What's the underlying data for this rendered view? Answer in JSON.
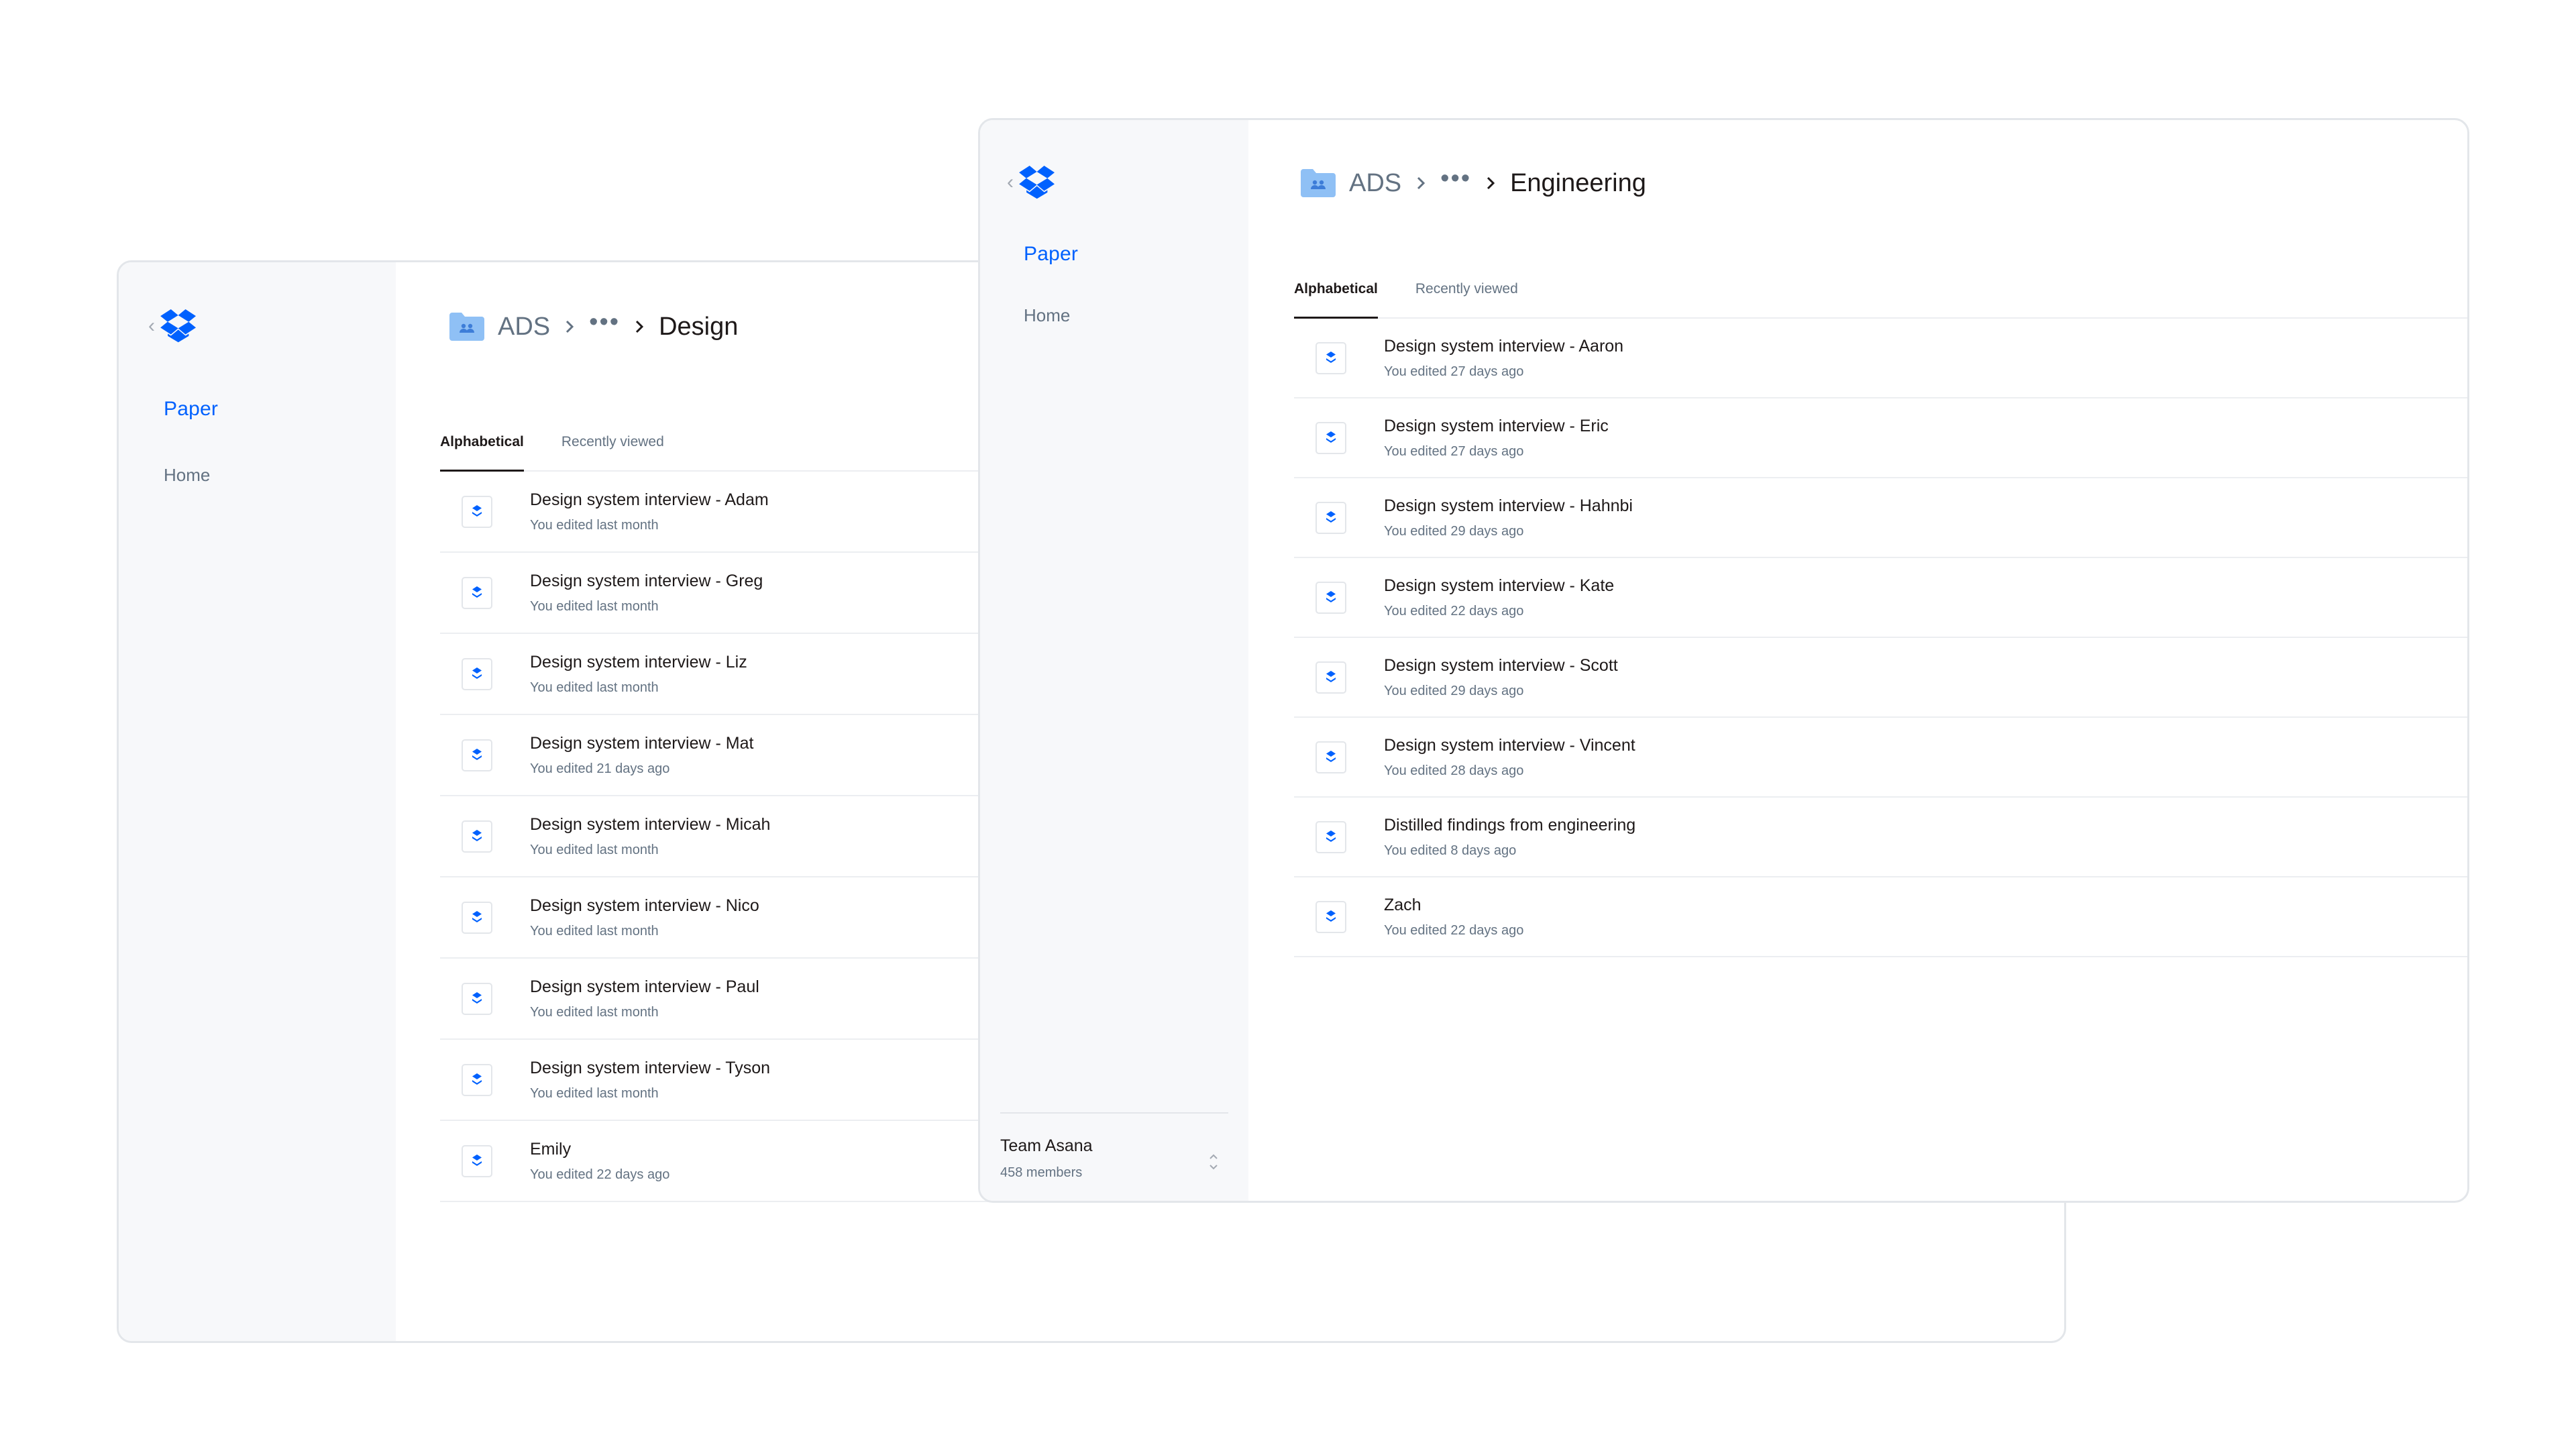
{
  "colors": {
    "accent": "#0061fe",
    "text_primary": "#1e1919",
    "text_secondary": "#637282",
    "folder": "#8fc0f5",
    "sidebar_bg": "#f7f8fa"
  },
  "back_window": {
    "sidebar": {
      "back_chevron": "‹",
      "logo_icon": "dropbox-logo-icon",
      "nav_paper": "Paper",
      "nav_home": "Home"
    },
    "breadcrumb": {
      "folder_icon": "team-folder-icon",
      "root": "ADS",
      "ellipsis": "•••",
      "current": "Design"
    },
    "tabs": [
      {
        "label": "Alphabetical",
        "active": true
      },
      {
        "label": "Recently viewed",
        "active": false
      }
    ],
    "docs": [
      {
        "title": "Design system interview - Adam",
        "subtitle": "You edited last month"
      },
      {
        "title": "Design system interview - Greg",
        "subtitle": "You edited last month"
      },
      {
        "title": "Design system interview - Liz",
        "subtitle": "You edited last month"
      },
      {
        "title": "Design system interview - Mat",
        "subtitle": "You edited 21 days ago"
      },
      {
        "title": "Design system interview - Micah",
        "subtitle": "You edited last month"
      },
      {
        "title": "Design system interview - Nico",
        "subtitle": "You edited last month"
      },
      {
        "title": "Design system interview - Paul",
        "subtitle": "You edited last month"
      },
      {
        "title": "Design system interview - Tyson",
        "subtitle": "You edited last month"
      },
      {
        "title": "Emily",
        "subtitle": "You edited 22 days ago"
      }
    ]
  },
  "front_window": {
    "sidebar": {
      "back_chevron": "‹",
      "logo_icon": "dropbox-logo-icon",
      "nav_paper": "Paper",
      "nav_home": "Home",
      "team_name": "Team Asana",
      "team_members": "458 members"
    },
    "breadcrumb": {
      "folder_icon": "team-folder-icon",
      "root": "ADS",
      "ellipsis": "•••",
      "current": "Engineering"
    },
    "tabs": [
      {
        "label": "Alphabetical",
        "active": true
      },
      {
        "label": "Recently viewed",
        "active": false
      }
    ],
    "docs": [
      {
        "title": "Design system interview - Aaron",
        "subtitle": "You edited 27 days ago"
      },
      {
        "title": "Design system interview - Eric",
        "subtitle": "You edited 27 days ago"
      },
      {
        "title": "Design system interview - Hahnbi",
        "subtitle": "You edited 29 days ago"
      },
      {
        "title": "Design system interview - Kate",
        "subtitle": "You edited 22 days ago"
      },
      {
        "title": "Design system interview - Scott",
        "subtitle": "You edited 29 days ago"
      },
      {
        "title": "Design system interview - Vincent",
        "subtitle": "You edited 28 days ago"
      },
      {
        "title": "Distilled findings from engineering",
        "subtitle": "You edited 8 days ago"
      },
      {
        "title": "Zach",
        "subtitle": "You edited 22 days ago"
      }
    ]
  }
}
